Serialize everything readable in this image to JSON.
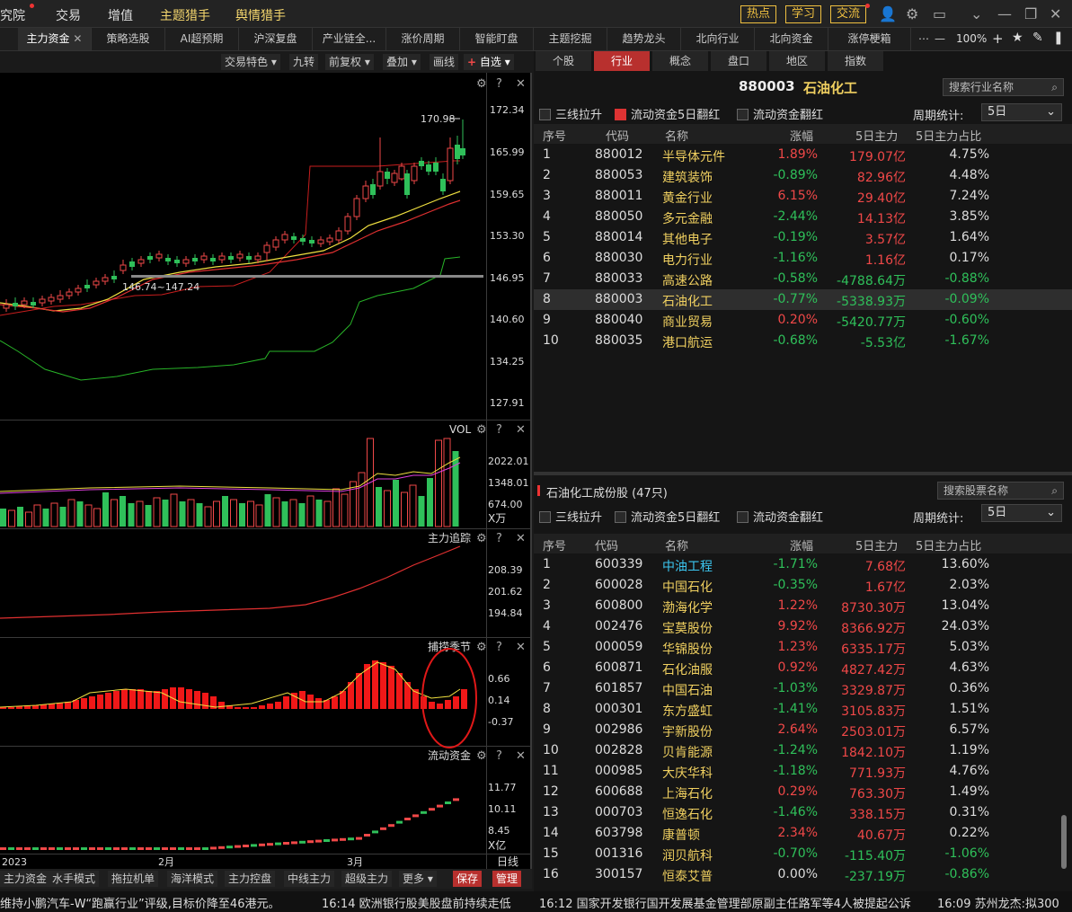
{
  "topnav": {
    "items": [
      "究院",
      "交易",
      "增值",
      "主题猎手",
      "舆情猎手"
    ],
    "buttons": [
      "热点",
      "学习",
      "交流"
    ]
  },
  "tabs": [
    "主力资金",
    "策略选股",
    "AI超预期",
    "沪深复盘",
    "产业链全...",
    "涨价周期",
    "智能盯盘",
    "主题挖掘",
    "趋势龙头",
    "北向行业",
    "北向资金",
    "涨停梗箱"
  ],
  "zoom": "100%",
  "chart_toolbar": [
    "交易特色",
    "九转",
    "前复权",
    "叠加",
    "画线",
    "自选"
  ],
  "price_axis": [
    "172.34",
    "165.99",
    "159.65",
    "153.30",
    "146.95",
    "140.60",
    "134.25",
    "127.91"
  ],
  "price_annotations": {
    "high": "170.98",
    "range": "146.74~147.24"
  },
  "vol": {
    "title": "VOL",
    "ticks": [
      "2022.01",
      "1348.01",
      "674.00"
    ],
    "unit": "X万"
  },
  "zhuli": {
    "title": "主力追踪",
    "ticks": [
      "208.39",
      "201.62",
      "194.84"
    ]
  },
  "buzhuo": {
    "title": "捕捞季节",
    "ticks": [
      "0.66",
      "0.14",
      "-0.37"
    ]
  },
  "liudong": {
    "title": "流动资金",
    "ticks": [
      "11.77",
      "10.11",
      "8.45"
    ],
    "unit": "X亿"
  },
  "date_axis": [
    "2023",
    "2月",
    "3月",
    "日线"
  ],
  "bottom_buttons": [
    "主力资金",
    "水手模式",
    "拖拉机单",
    "海洋模式",
    "主力控盘",
    "中线主力",
    "超级主力",
    "更多",
    "保存",
    "管理"
  ],
  "right": {
    "tabs": [
      "个股",
      "行业",
      "概念",
      "盘口",
      "地区",
      "指数"
    ],
    "industry_title_code": "880003",
    "industry_title_name": "石油化工",
    "search_industry": "搜索行业名称",
    "filters": [
      "三线拉升",
      "流动资金5日翻红",
      "流动资金翻红"
    ],
    "period_label": "周期统计:",
    "period_value": "5日",
    "headers": [
      "序号",
      "代码",
      "名称",
      "涨幅",
      "5日主力",
      "5日主力占比"
    ],
    "industry_rows": [
      [
        "1",
        "880012",
        "半导体元件",
        "1.89%",
        "179.07亿",
        "4.75%"
      ],
      [
        "2",
        "880053",
        "建筑装饰",
        "-0.89%",
        "82.96亿",
        "4.48%"
      ],
      [
        "3",
        "880011",
        "黄金行业",
        "6.15%",
        "29.40亿",
        "7.24%"
      ],
      [
        "4",
        "880050",
        "多元金融",
        "-2.44%",
        "14.13亿",
        "3.85%"
      ],
      [
        "5",
        "880014",
        "其他电子",
        "-0.19%",
        "3.57亿",
        "1.64%"
      ],
      [
        "6",
        "880030",
        "电力行业",
        "-1.16%",
        "1.16亿",
        "0.17%"
      ],
      [
        "7",
        "880033",
        "高速公路",
        "-0.58%",
        "-4788.64万",
        "-0.88%"
      ],
      [
        "8",
        "880003",
        "石油化工",
        "-0.77%",
        "-5338.93万",
        "-0.09%"
      ],
      [
        "9",
        "880040",
        "商业贸易",
        "0.20%",
        "-5420.77万",
        "-0.60%"
      ],
      [
        "10",
        "880035",
        "港口航运",
        "-0.68%",
        "-5.53亿",
        "-1.67%"
      ]
    ],
    "stocks_title": "石油化工成份股 (47只)",
    "search_stock": "搜索股票名称",
    "stock_rows": [
      [
        "1",
        "600339",
        "中油工程",
        "-1.71%",
        "7.68亿",
        "13.60%"
      ],
      [
        "2",
        "600028",
        "中国石化",
        "-0.35%",
        "1.67亿",
        "2.03%"
      ],
      [
        "3",
        "600800",
        "渤海化学",
        "1.22%",
        "8730.30万",
        "13.04%"
      ],
      [
        "4",
        "002476",
        "宝莫股份",
        "9.92%",
        "8366.92万",
        "24.03%"
      ],
      [
        "5",
        "000059",
        "华锦股份",
        "1.23%",
        "6335.17万",
        "5.03%"
      ],
      [
        "6",
        "600871",
        "石化油服",
        "0.92%",
        "4827.42万",
        "4.63%"
      ],
      [
        "7",
        "601857",
        "中国石油",
        "-1.03%",
        "3329.87万",
        "0.36%"
      ],
      [
        "8",
        "000301",
        "东方盛虹",
        "-1.41%",
        "3105.83万",
        "1.51%"
      ],
      [
        "9",
        "002986",
        "宇新股份",
        "2.64%",
        "2503.01万",
        "6.57%"
      ],
      [
        "10",
        "002828",
        "贝肯能源",
        "-1.24%",
        "1842.10万",
        "1.19%"
      ],
      [
        "11",
        "000985",
        "大庆华科",
        "-1.18%",
        "771.93万",
        "4.76%"
      ],
      [
        "12",
        "600688",
        "上海石化",
        "0.29%",
        "763.30万",
        "1.49%"
      ],
      [
        "13",
        "000703",
        "恒逸石化",
        "-1.46%",
        "338.15万",
        "0.31%"
      ],
      [
        "14",
        "603798",
        "康普顿",
        "2.34%",
        "40.67万",
        "0.22%"
      ],
      [
        "15",
        "001316",
        "润贝航科",
        "-0.70%",
        "-115.40万",
        "-1.06%"
      ],
      [
        "16",
        "300157",
        "恒泰艾普",
        "0.00%",
        "-237.19万",
        "-0.86%"
      ]
    ]
  },
  "ticker": [
    "维持小鹏汽车-W“跑赢行业”评级,目标价降至46港元。",
    "16:14 欧洲银行股美股盘前持续走低",
    "16:12 国家开发银行国开发展基金管理部原副主任路军等4人被提起公诉",
    "16:09 苏州龙杰:拟300"
  ],
  "colors": {
    "up": "#f04848",
    "down": "#2fc05a",
    "accent": "#b8302e",
    "highlight": "#f0c040"
  }
}
